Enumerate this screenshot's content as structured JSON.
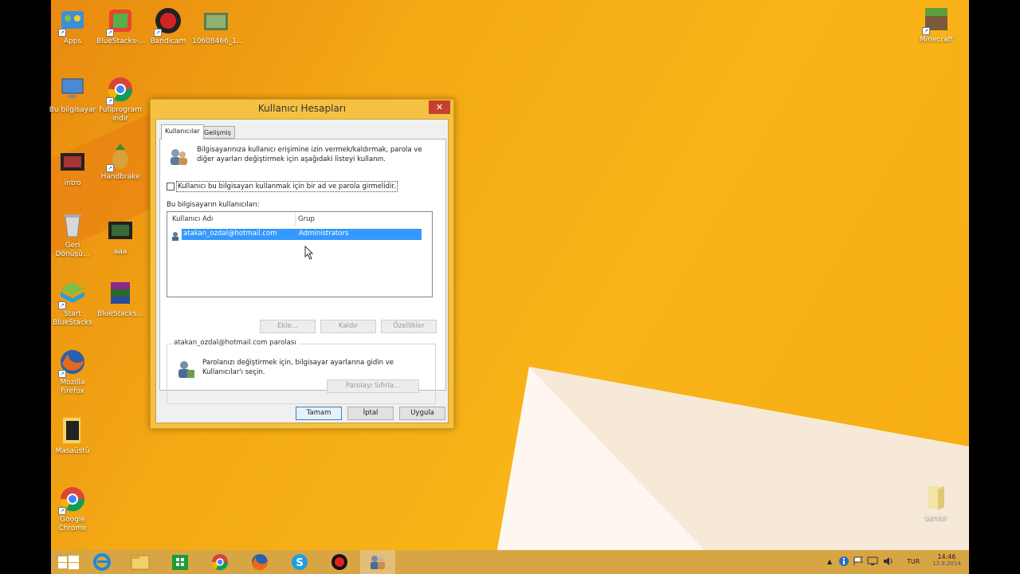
{
  "desktop": {
    "icons": [
      {
        "label": "Apps",
        "icon": "apps-icon"
      },
      {
        "label": "BlueStacks-...",
        "icon": "bluestacks-icon"
      },
      {
        "label": "Bandicam",
        "icon": "bandicam-icon"
      },
      {
        "label": "10608466_1...",
        "icon": "image-file-icon"
      },
      {
        "label": "Minecraft",
        "icon": "minecraft-icon"
      },
      {
        "label": "Bu bilgisayar",
        "icon": "computer-icon"
      },
      {
        "label": "Fullprogram indir",
        "icon": "chrome-icon"
      },
      {
        "label": "intro",
        "icon": "video-file-icon"
      },
      {
        "label": "Handbrake",
        "icon": "handbrake-icon"
      },
      {
        "label": "Geri Dönüşü...",
        "icon": "recycle-bin-icon"
      },
      {
        "label": "aaa",
        "icon": "video-file-icon"
      },
      {
        "label": "Start BlueStacks",
        "icon": "bluestacks-icon"
      },
      {
        "label": "BlueStacks...",
        "icon": "winrar-icon"
      },
      {
        "label": "Mozilla Firefox",
        "icon": "firefox-icon"
      },
      {
        "label": "Masaüstü",
        "icon": "folder-icon"
      },
      {
        "label": "Google Chrome",
        "icon": "chrome-icon"
      },
      {
        "label": "server",
        "icon": "folder-icon"
      }
    ]
  },
  "dialog": {
    "title": "Kullanıcı Hesapları",
    "close_label": "✕",
    "tabs": [
      "Kullanıcılar",
      "Gelişmiş"
    ],
    "intro_text": "Bilgisayarınıza kullanıcı erişimine izin vermek/kaldırmak, parola ve diğer ayarları değiştirmek için aşağıdaki listeyi kullanın.",
    "checkbox_label": "Kullanıcı bu bilgisayarı kullanmak için bir ad ve parola girmelidir.",
    "checkbox_checked": false,
    "users_label": "Bu bilgisayarın kullanıcıları:",
    "columns": [
      "Kullanıcı Adı",
      "Grup"
    ],
    "users": [
      {
        "name": "atakan_ozdal@hotmail.com",
        "group": "Administrators",
        "selected": true
      }
    ],
    "buttons": {
      "add": "Ekle...",
      "remove": "Kaldır",
      "properties": "Özellikler"
    },
    "password_group_title": "atakan_ozdal@hotmail.com parolası",
    "password_text": "Parolanızı değiştirmek için, bilgisayar ayarlarına gidin ve Kullanıcılar'ı seçin.",
    "reset_password": "Parolayı Sıfırla...",
    "footer": {
      "ok": "Tamam",
      "cancel": "İptal",
      "apply": "Uygula"
    }
  },
  "taskbar": {
    "items": [
      {
        "icon": "windows-start-icon"
      },
      {
        "icon": "internet-explorer-icon"
      },
      {
        "icon": "file-explorer-icon"
      },
      {
        "icon": "store-icon"
      },
      {
        "icon": "chrome-icon"
      },
      {
        "icon": "firefox-icon"
      },
      {
        "icon": "skype-icon"
      },
      {
        "icon": "bandicam-icon"
      },
      {
        "icon": "user-accounts-icon",
        "active": true
      }
    ],
    "language": "TUR",
    "time": "14:46",
    "date": "13.9.2014"
  },
  "colors": {
    "accent": "#f6ad13",
    "taskbar": "#d8a544",
    "selection": "#3399ff"
  }
}
